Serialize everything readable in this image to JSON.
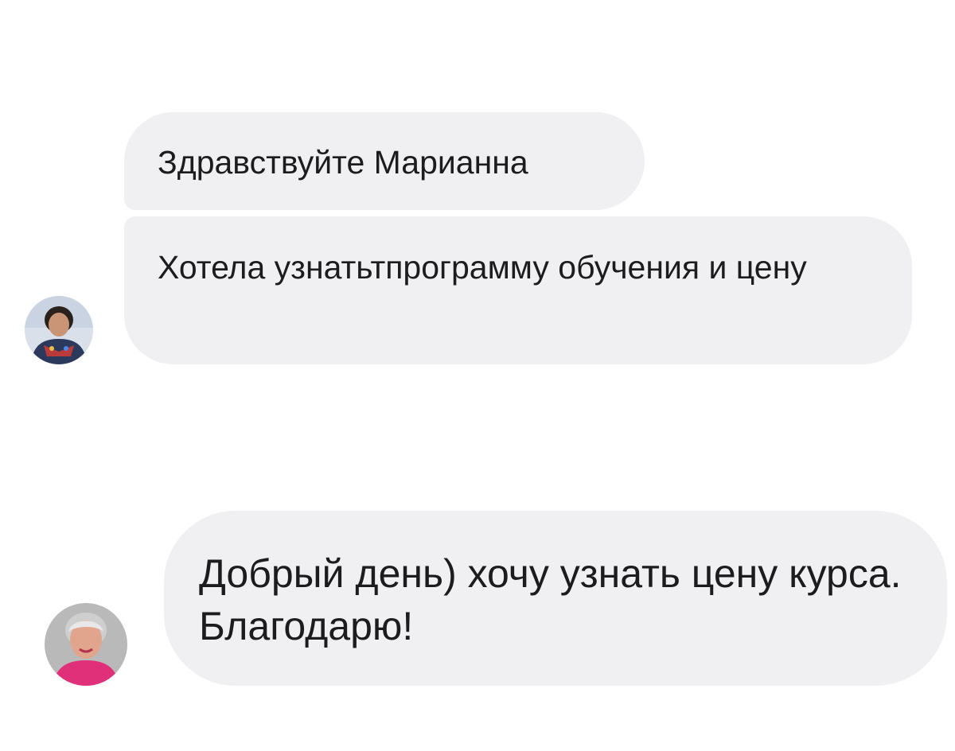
{
  "conversation": {
    "messages": [
      {
        "text": "Здравствуйте Марианна",
        "avatar_icon": "user-avatar-icon"
      },
      {
        "text": "Хотела узнатьтпрограмму обучения и цену",
        "avatar_icon": "user-avatar-icon"
      },
      {
        "text": "Добрый день) хочу узнать цену курса. Благодарю!",
        "avatar_icon": "user-avatar-icon"
      }
    ]
  },
  "colors": {
    "background": "#ffffff",
    "bubble": "#f0f0f3",
    "text": "#1c1c1e"
  }
}
